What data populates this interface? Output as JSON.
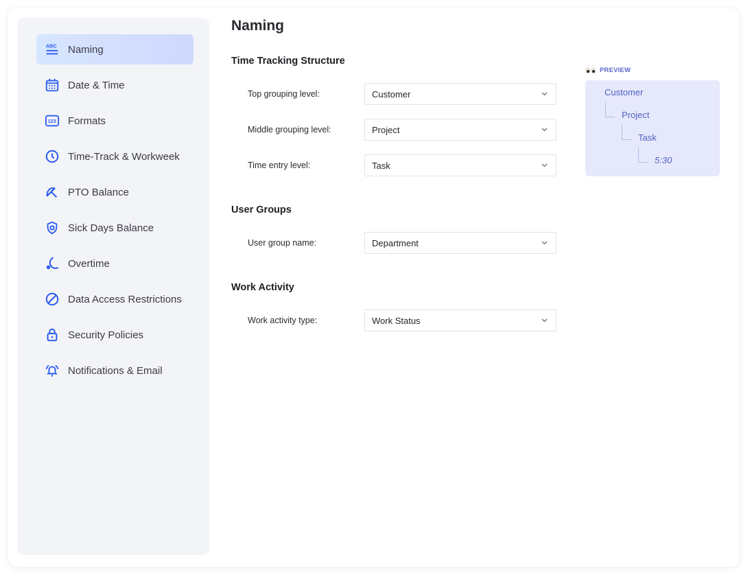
{
  "sidebar": {
    "active_index": 0,
    "accent_color": "#2a5cf0",
    "items": [
      {
        "label": "Naming",
        "icon": "abc-list-icon"
      },
      {
        "label": "Date & Time",
        "icon": "calendar-icon"
      },
      {
        "label": "Formats",
        "icon": "numbers-123-icon"
      },
      {
        "label": "Time-Track & Workweek",
        "icon": "clock-icon"
      },
      {
        "label": "PTO Balance",
        "icon": "beach-umbrella-icon"
      },
      {
        "label": "Sick Days Balance",
        "icon": "shield-plus-icon"
      },
      {
        "label": "Overtime",
        "icon": "moon-icon"
      },
      {
        "label": "Data Access Restrictions",
        "icon": "prohibited-icon"
      },
      {
        "label": "Security Policies",
        "icon": "lock-icon"
      },
      {
        "label": "Notifications & Email",
        "icon": "bell-ringing-icon"
      }
    ]
  },
  "main": {
    "title": "Naming",
    "sections": [
      {
        "title": "Time Tracking Structure",
        "fields": [
          {
            "label": "Top grouping level:",
            "value": "Customer"
          },
          {
            "label": "Middle grouping level:",
            "value": "Project"
          },
          {
            "label": "Time entry level:",
            "value": "Task"
          }
        ]
      },
      {
        "title": "User Groups",
        "fields": [
          {
            "label": "User group name:",
            "value": "Department"
          }
        ]
      },
      {
        "title": "Work Activity",
        "fields": [
          {
            "label": "Work activity type:",
            "value": "Work Status"
          }
        ]
      }
    ]
  },
  "preview": {
    "label": "PREVIEW",
    "icon": "eyes-icon",
    "tree": [
      "Customer",
      "Project",
      "Task",
      "5:30"
    ]
  }
}
